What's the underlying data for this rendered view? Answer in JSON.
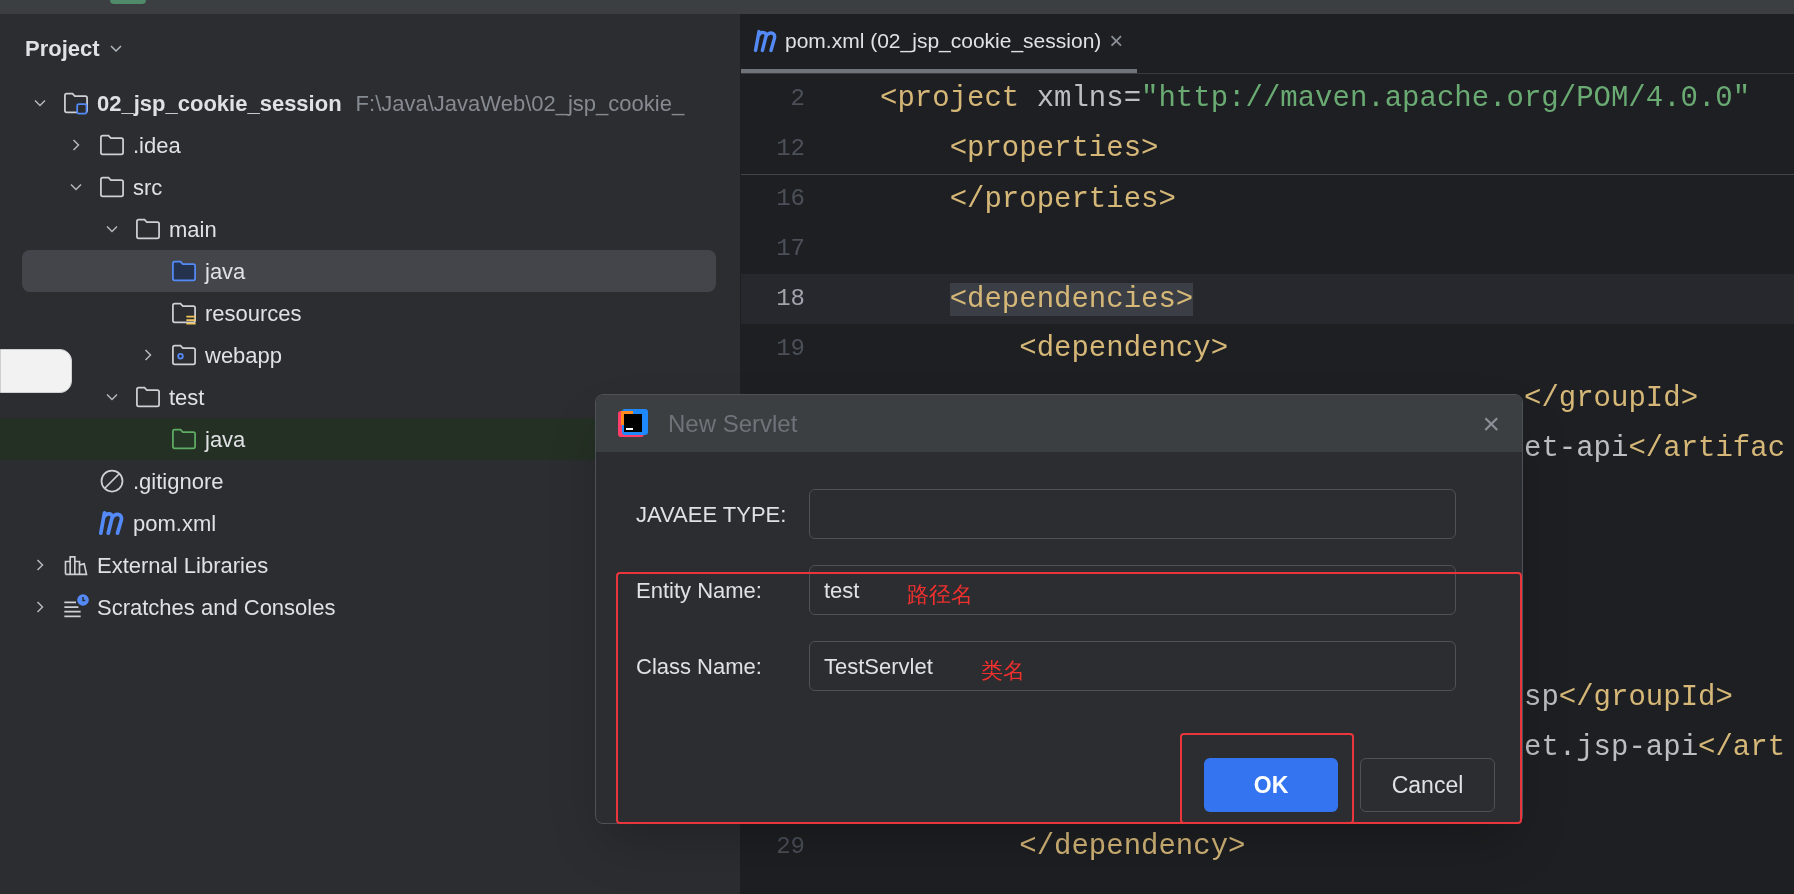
{
  "project_panel": {
    "title": "Project",
    "tree": [
      {
        "label": "02_jsp_cookie_session",
        "path": "F:\\Java\\JavaWeb\\02_jsp_cookie_",
        "kind": "module",
        "expanded": true,
        "selected": false,
        "highlighted": false,
        "children": [
          {
            "label": ".idea",
            "kind": "folder",
            "expanded": false,
            "selected": false,
            "highlighted": false
          },
          {
            "label": "src",
            "kind": "folder",
            "expanded": true,
            "selected": false,
            "highlighted": false,
            "children": [
              {
                "label": "main",
                "kind": "folder",
                "expanded": true,
                "selected": false,
                "highlighted": false,
                "children": [
                  {
                    "label": "java",
                    "kind": "source-root",
                    "selected": true,
                    "highlighted": false
                  },
                  {
                    "label": "resources",
                    "kind": "resources-root",
                    "selected": false,
                    "highlighted": false
                  },
                  {
                    "label": "webapp",
                    "kind": "web-folder",
                    "expanded": false,
                    "selected": false,
                    "highlighted": false
                  }
                ]
              },
              {
                "label": "test",
                "kind": "folder",
                "expanded": true,
                "selected": false,
                "highlighted": false,
                "children": [
                  {
                    "label": "java",
                    "kind": "test-root",
                    "selected": false,
                    "highlighted": true
                  }
                ]
              }
            ]
          },
          {
            "label": ".gitignore",
            "kind": "ignore-file",
            "selected": false,
            "highlighted": false
          },
          {
            "label": "pom.xml",
            "kind": "maven-file",
            "selected": false,
            "highlighted": false
          }
        ]
      },
      {
        "label": "External Libraries",
        "kind": "libraries",
        "expanded": false,
        "selected": false,
        "highlighted": false
      },
      {
        "label": "Scratches and Consoles",
        "kind": "scratches",
        "expanded": false,
        "selected": false,
        "highlighted": false
      }
    ]
  },
  "editor": {
    "tab": {
      "title": "pom.xml (02_jsp_cookie_session)",
      "close": "×",
      "selected": true
    },
    "sticky_lines": [
      {
        "number": "2",
        "current": false,
        "segments": [
          {
            "kind": "tag",
            "text": "<project"
          },
          {
            "kind": "plain",
            "text": " xmlns="
          },
          {
            "kind": "string",
            "text": "\"http://maven.apache.org/POM/4.0.0\""
          }
        ]
      },
      {
        "number": "12",
        "current": false,
        "segments": [
          {
            "kind": "tag",
            "text": "    <properties>"
          }
        ]
      }
    ],
    "lines": [
      {
        "kind": "code",
        "number": "16",
        "current": false,
        "segments": [
          {
            "kind": "tag",
            "text": "    </properties>"
          }
        ]
      },
      {
        "kind": "code",
        "number": "17",
        "current": false
      },
      {
        "kind": "code",
        "number": "18",
        "current": true,
        "segments": [
          {
            "kind": "tag-match",
            "text": "    <dependencies>"
          }
        ]
      },
      {
        "kind": "code",
        "number": "19",
        "current": false,
        "segments": [
          {
            "kind": "tag",
            "text": "        <dependency>"
          }
        ]
      },
      {
        "kind": "partial",
        "segments": [
          {
            "kind": "tag",
            "text": "</groupId>"
          }
        ]
      },
      {
        "kind": "partial",
        "segments": [
          {
            "kind": "plain",
            "text": "et-api"
          },
          {
            "kind": "tag",
            "text": "</artifac"
          }
        ]
      },
      {
        "kind": "hidden"
      },
      {
        "kind": "hidden"
      },
      {
        "kind": "hidden"
      },
      {
        "kind": "hidden"
      },
      {
        "kind": "partial",
        "segments": [
          {
            "kind": "plain",
            "text": "sp"
          },
          {
            "kind": "tag",
            "text": "</groupId>"
          }
        ]
      },
      {
        "kind": "partial",
        "segments": [
          {
            "kind": "plain",
            "text": "et.jsp-api"
          },
          {
            "kind": "tag",
            "text": "</art"
          }
        ]
      },
      {
        "kind": "hidden"
      },
      {
        "kind": "code",
        "number": "29",
        "current": false,
        "segments": [
          {
            "kind": "tag",
            "text": "        </dependency>"
          }
        ]
      }
    ]
  },
  "dialog": {
    "title": "New Servlet",
    "close": "×",
    "fields": [
      {
        "label": "JAVAEE TYPE:"
      },
      {
        "label": "Entity Name:",
        "value": "test",
        "note": "路径名"
      },
      {
        "label": "Class Name:",
        "value": "TestServlet",
        "note": "类名"
      }
    ],
    "buttons": [
      {
        "label": "OK",
        "kind": "primary"
      },
      {
        "label": "Cancel",
        "kind": "secondary"
      }
    ]
  }
}
